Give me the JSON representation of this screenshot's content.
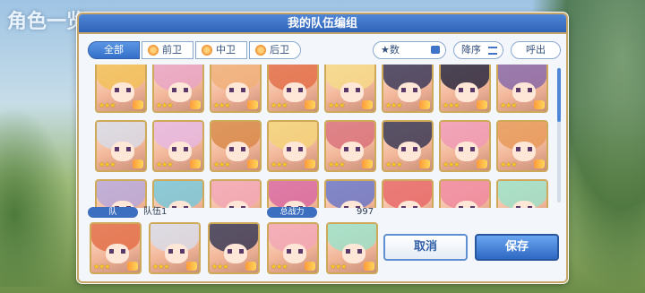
{
  "background": {
    "title": "角色一览"
  },
  "dialog": {
    "title": "我的队伍编组"
  },
  "toolbar": {
    "tabs": [
      {
        "label": "全部"
      },
      {
        "label": "前卫"
      },
      {
        "label": "中卫"
      },
      {
        "label": "后卫"
      }
    ],
    "sort_key_label": "★数",
    "order_label": "降序",
    "call_label": "呼出"
  },
  "team": {
    "tag_label": "队",
    "name": "队伍1",
    "power_label": "总战力",
    "power_value": "997"
  },
  "buttons": {
    "cancel": "取消",
    "save": "保存"
  },
  "stars": "★★★",
  "colors": {
    "accent": "#3470c9",
    "gold_border": "#cfa95a"
  }
}
